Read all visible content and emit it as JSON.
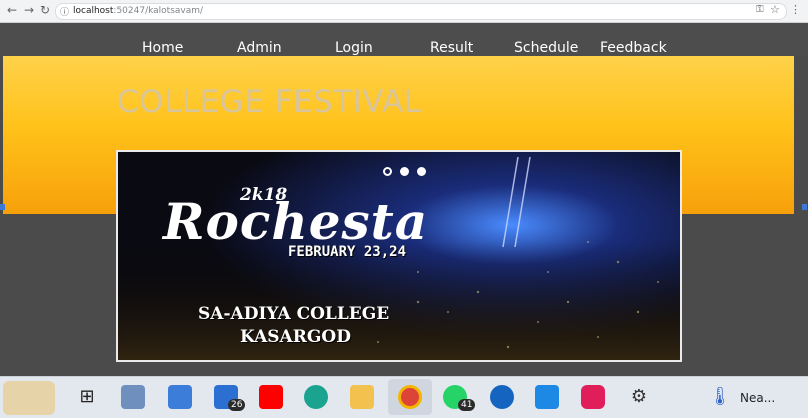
{
  "browser": {
    "url_host": "localhost",
    "url_rest": ":50247/kalotsavam/"
  },
  "nav": {
    "items": [
      "Home",
      "Admin",
      "Login",
      "Result",
      "Schedule",
      "Feedback"
    ]
  },
  "site": {
    "title": "COLLEGE FESTIVAL"
  },
  "slider": {
    "year": "2k18",
    "event": "Rochesta",
    "date": "FEBRUARY 23,24",
    "college_line1": "SA-ADIYA COLLEGE",
    "college_line2": "KASARGOD",
    "active_dot": 2
  },
  "taskbar": {
    "mail_badge": "26",
    "whatsapp_badge": "41",
    "weather_text": "Nea..."
  }
}
